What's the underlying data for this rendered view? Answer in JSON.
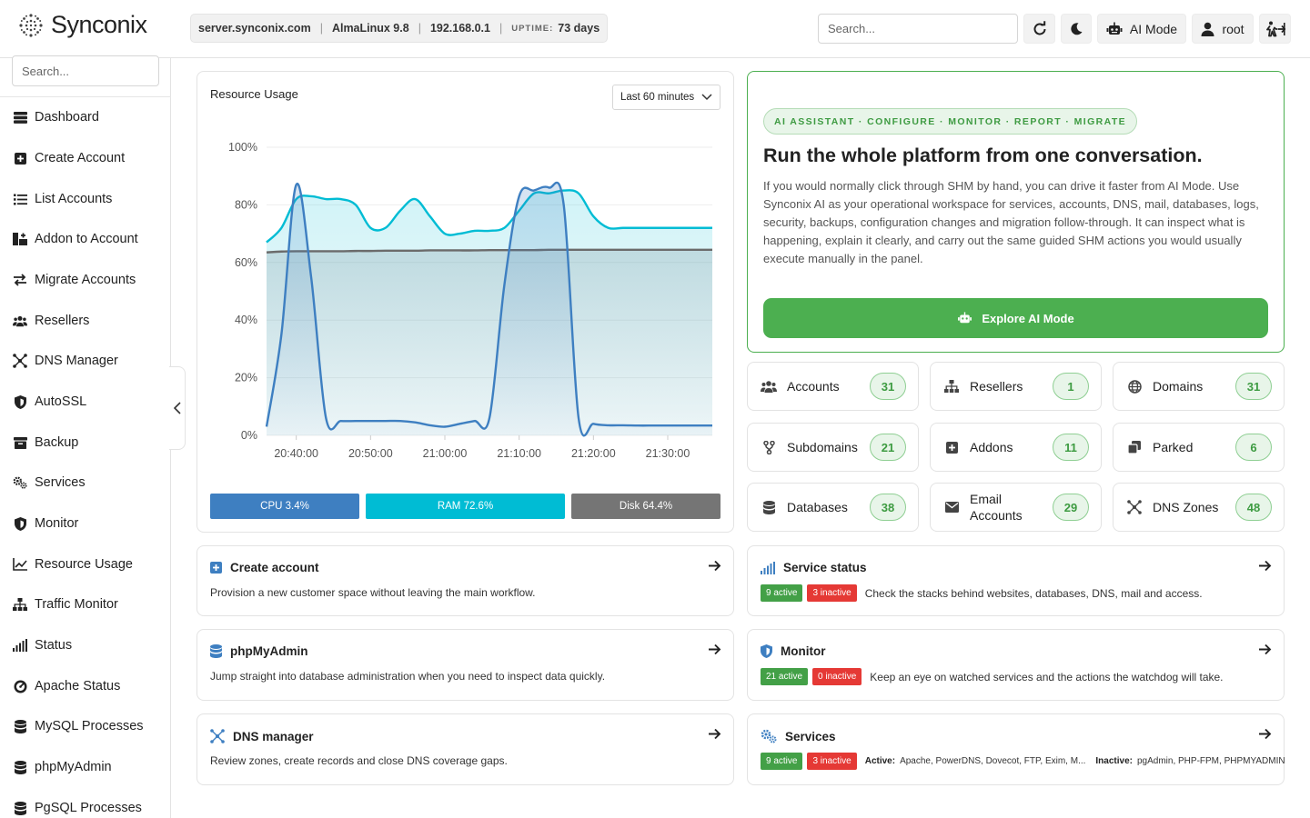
{
  "app": {
    "brand": "Synconix"
  },
  "server": {
    "hostname": "server.synconix.com",
    "os": "AlmaLinux 9.8",
    "ip": "192.168.0.1",
    "uptime_label": "UPTIME:",
    "uptime_value": "73 days"
  },
  "topbar": {
    "search_placeholder": "Search...",
    "ai_mode_label": "AI Mode",
    "user_label": "root"
  },
  "sidebar": {
    "search_placeholder": "Search...",
    "items": [
      {
        "label": "Dashboard",
        "icon": "dashboard-icon"
      },
      {
        "label": "Create Account",
        "icon": "plus-square-icon"
      },
      {
        "label": "List Accounts",
        "icon": "list-icon"
      },
      {
        "label": "Addon to Account",
        "icon": "addon-icon"
      },
      {
        "label": "Migrate Accounts",
        "icon": "swap-arrows-icon"
      },
      {
        "label": "Resellers",
        "icon": "users-icon"
      },
      {
        "label": "DNS Manager",
        "icon": "dns-nodes-icon"
      },
      {
        "label": "AutoSSL",
        "icon": "shield-icon"
      },
      {
        "label": "Backup",
        "icon": "archive-icon"
      },
      {
        "label": "Services",
        "icon": "cogs-icon"
      },
      {
        "label": "Monitor",
        "icon": "shield-icon"
      },
      {
        "label": "Resource Usage",
        "icon": "line-chart-icon"
      },
      {
        "label": "Traffic Monitor",
        "icon": "sitemap-icon"
      },
      {
        "label": "Status",
        "icon": "signal-bars-icon"
      },
      {
        "label": "Apache Status",
        "icon": "gauge-icon"
      },
      {
        "label": "MySQL Processes",
        "icon": "database-icon"
      },
      {
        "label": "phpMyAdmin",
        "icon": "database-icon"
      },
      {
        "label": "PgSQL Processes",
        "icon": "database-icon"
      }
    ]
  },
  "resource": {
    "title": "Resource Usage",
    "range": "Last 60 minutes",
    "cpu_label": "CPU 3.4%",
    "ram_label": "RAM 72.6%",
    "disk_label": "Disk 64.4%",
    "colors": {
      "cpu": "#3e7fc1",
      "ram": "#00bcd4",
      "disk": "#757575"
    }
  },
  "chart_data": {
    "type": "line",
    "x": [
      "20:36",
      "20:38",
      "20:40",
      "20:42",
      "20:44",
      "20:46",
      "20:48",
      "20:50",
      "20:52",
      "20:54",
      "20:56",
      "20:58",
      "21:00",
      "21:02",
      "21:04",
      "21:06",
      "21:08",
      "21:10",
      "21:12",
      "21:14",
      "21:16",
      "21:18",
      "21:20",
      "21:22",
      "21:24",
      "21:26",
      "21:28",
      "21:30",
      "21:32",
      "21:34",
      "21:36"
    ],
    "xticks": [
      "20:40:00",
      "20:50:00",
      "21:00:00",
      "21:10:00",
      "21:20:00",
      "21:30:00"
    ],
    "yticks": [
      "0%",
      "20%",
      "40%",
      "60%",
      "80%",
      "100%"
    ],
    "ylim": [
      0,
      100
    ],
    "series": [
      {
        "name": "RAM",
        "values": [
          67,
          72,
          82,
          83,
          82,
          82,
          80,
          72,
          72,
          78,
          82,
          76,
          70,
          70,
          71,
          71,
          72,
          78,
          84,
          84,
          85,
          84,
          76,
          72,
          72,
          72,
          72,
          72,
          72,
          72,
          72
        ]
      },
      {
        "name": "Disk",
        "values": [
          63.5,
          63.8,
          63.9,
          63.9,
          63.9,
          63.9,
          64,
          64,
          64.1,
          64.1,
          64.1,
          64.2,
          64.2,
          64.2,
          64.2,
          64.3,
          64.3,
          64.3,
          64.3,
          64.4,
          64.4,
          64.4,
          64.4,
          64.4,
          64.4,
          64.4,
          64.4,
          64.4,
          64.4,
          64.4,
          64.4
        ]
      },
      {
        "name": "CPU",
        "values": [
          3,
          35,
          87,
          55,
          6,
          5,
          5,
          5,
          5,
          5,
          4.5,
          3.5,
          3,
          4,
          5,
          6,
          52,
          83,
          85,
          86,
          80,
          6,
          4,
          3.5,
          3.5,
          3.4,
          3.4,
          3.4,
          3.4,
          3.4,
          3.4
        ]
      }
    ]
  },
  "ai": {
    "tag": "AI ASSISTANT · CONFIGURE · MONITOR · REPORT · MIGRATE",
    "title": "Run the whole platform from one conversation.",
    "body": "If you would normally click through SHM by hand, you can drive it faster from AI Mode. Use Synconix AI as your operational workspace for services, accounts, DNS, mail, databases, logs, security, backups, configuration changes and migration follow-through. It can inspect what is happening, explain it clearly, and carry out the same guided SHM actions you would usually execute manually in the panel.",
    "button": "Explore AI Mode"
  },
  "stats": [
    {
      "label": "Accounts",
      "count": "31"
    },
    {
      "label": "Resellers",
      "count": "1"
    },
    {
      "label": "Domains",
      "count": "31"
    },
    {
      "label": "Subdomains",
      "count": "21"
    },
    {
      "label": "Addons",
      "count": "11"
    },
    {
      "label": "Parked",
      "count": "6"
    },
    {
      "label": "Databases",
      "count": "38"
    },
    {
      "label": "Email Accounts",
      "count": "29"
    },
    {
      "label": "DNS Zones",
      "count": "48"
    }
  ],
  "quick": {
    "create": {
      "title": "Create account",
      "desc": "Provision a new customer space without leaving the main workflow."
    },
    "pma": {
      "title": "phpMyAdmin",
      "desc": "Jump straight into database administration when you need to inspect data quickly."
    },
    "dns": {
      "title": "DNS manager",
      "desc": "Review zones, create records and close DNS coverage gaps."
    },
    "service_status": {
      "title": "Service status",
      "active": "9 active",
      "inactive": "3 inactive",
      "desc": "Check the stacks behind websites, databases, DNS, mail and access."
    },
    "monitor": {
      "title": "Monitor",
      "active": "21 active",
      "inactive": "0 inactive",
      "desc": "Keep an eye on watched services and the actions the watchdog will take."
    },
    "services": {
      "title": "Services",
      "active": "9 active",
      "inactive": "3 inactive",
      "active_label": "Active:",
      "active_list": "Apache, PowerDNS, Dovecot, FTP, Exim, M...",
      "inactive_label": "Inactive:",
      "inactive_list": "pgAdmin, PHP-FPM, PHPMYADMIN"
    }
  }
}
